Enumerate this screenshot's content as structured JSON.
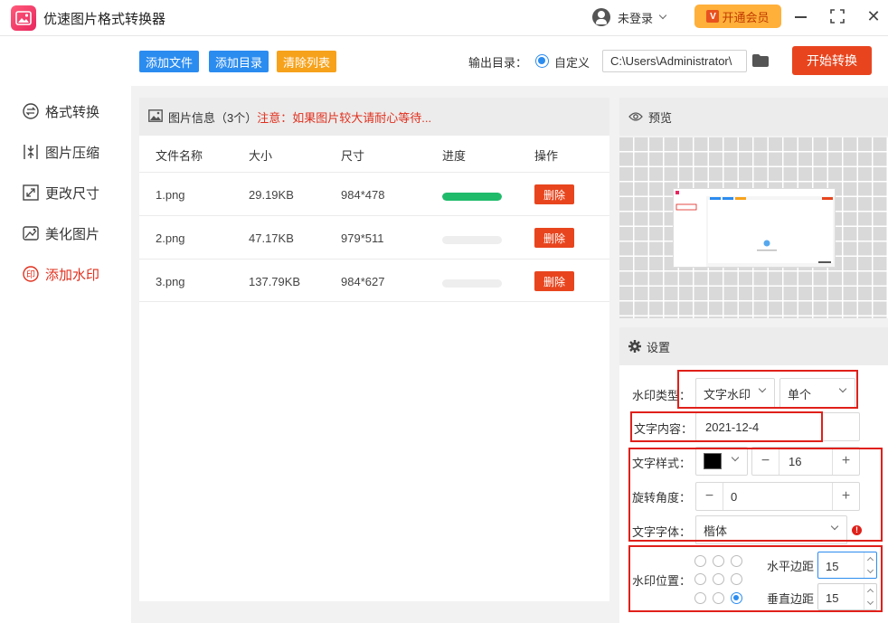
{
  "app": {
    "title": "优速图片格式转换器"
  },
  "user": {
    "login_label": "未登录",
    "vip_label": "开通会员",
    "vip_badge": "V"
  },
  "sidebar": {
    "items": [
      {
        "label": "格式转换",
        "icon": "format-convert-icon"
      },
      {
        "label": "图片压缩",
        "icon": "compress-icon"
      },
      {
        "label": "更改尺寸",
        "icon": "resize-icon"
      },
      {
        "label": "美化图片",
        "icon": "beautify-icon"
      },
      {
        "label": "添加水印",
        "icon": "watermark-icon",
        "active": true
      }
    ]
  },
  "toolbar": {
    "add_file": "添加文件",
    "add_dir": "添加目录",
    "clear_list": "清除列表",
    "output_label": "输出目录：",
    "custom_label": "自定义",
    "output_path": "C:\\Users\\Administrator\\",
    "start_label": "开始转换"
  },
  "file_list": {
    "header_title": "图片信息（3个）",
    "header_note": "注意：如果图片较大请耐心等待...",
    "columns": [
      "文件名称",
      "大小",
      "尺寸",
      "进度",
      "操作"
    ],
    "rows": [
      {
        "name": "1.png",
        "size": "29.19KB",
        "dims": "984*478",
        "progress": 1.0,
        "action": "删除"
      },
      {
        "name": "2.png",
        "size": "47.17KB",
        "dims": "979*511",
        "progress": 0.0,
        "action": "删除"
      },
      {
        "name": "3.png",
        "size": "137.79KB",
        "dims": "984*627",
        "progress": 0.0,
        "action": "删除"
      }
    ]
  },
  "preview": {
    "title": "预览"
  },
  "settings": {
    "title": "设置",
    "wm_type_label": "水印类型：",
    "wm_type_value": "文字水印",
    "wm_mode_value": "单个",
    "text_label": "文字内容：",
    "text_value": "2021-12-4",
    "style_label": "文字样式：",
    "text_color": "#000000",
    "font_size": "16",
    "rotate_label": "旋转角度：",
    "rotate_value": "0",
    "font_label": "文字字体：",
    "font_value": "楷体",
    "position_label": "水印位置：",
    "position_selected": "bottom-right",
    "h_margin_label": "水平边距",
    "h_margin_value": "15",
    "v_margin_label": "垂直边距",
    "v_margin_value": "15"
  },
  "colors": {
    "accent": "#2b8cf0",
    "danger": "#e8451e",
    "highlight": "#e0201a",
    "progress": "#1fbb6b",
    "vip": "#ffb03a"
  }
}
